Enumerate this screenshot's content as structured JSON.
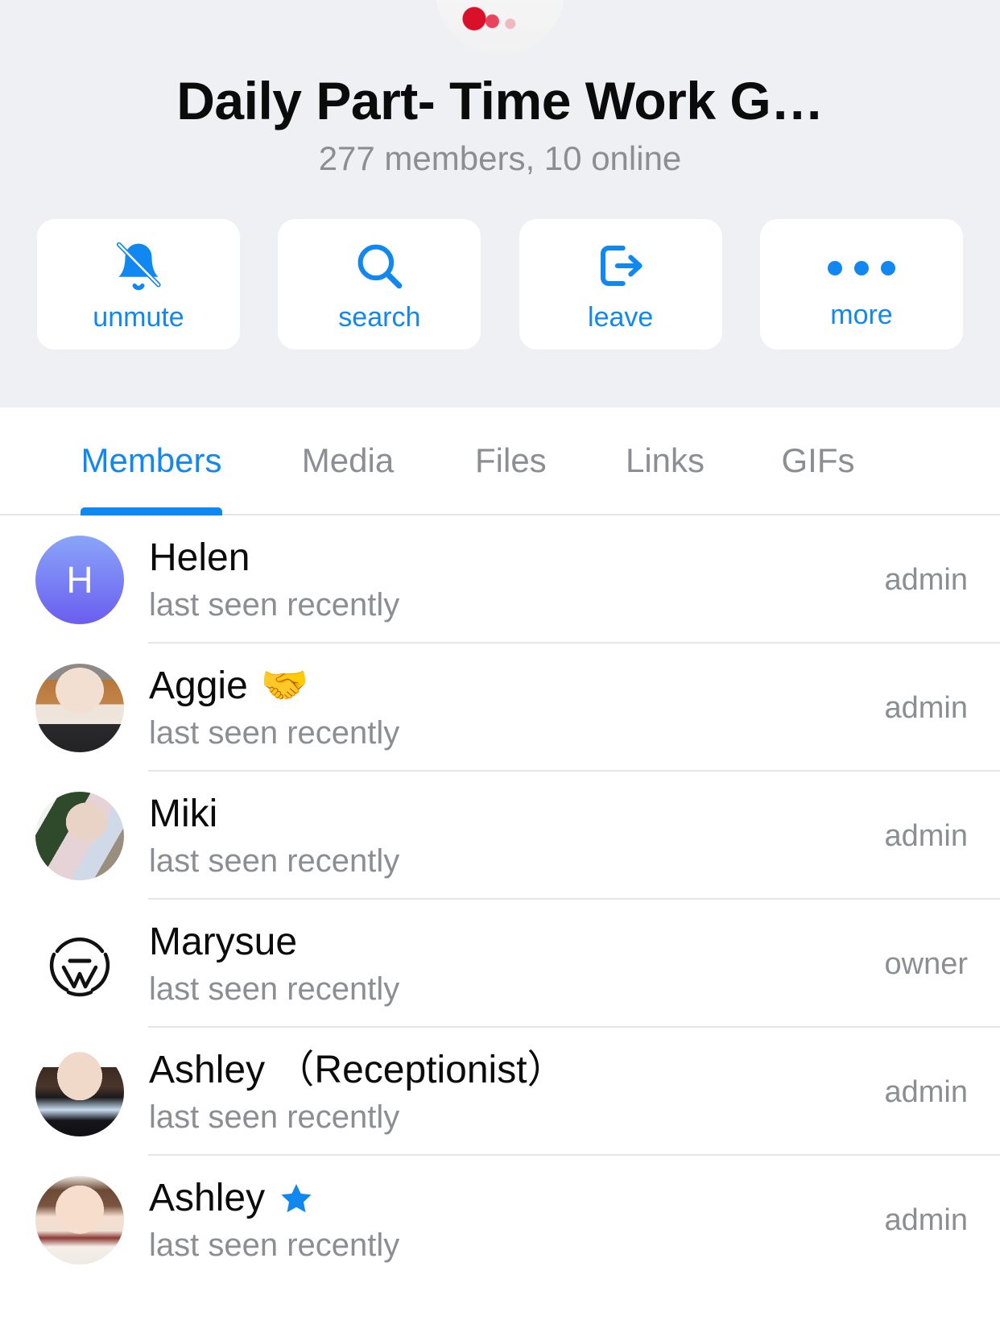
{
  "header": {
    "avatar_icon": "group-photo-avatar",
    "title": "Daily Part- Time Work G…",
    "subtitle": "277 members, 10 online",
    "background_color": "#eef0f4",
    "accent_color": "#1187f2"
  },
  "actions": [
    {
      "label": "unmute",
      "icon": "bell-slash-icon"
    },
    {
      "label": "search",
      "icon": "search-icon"
    },
    {
      "label": "leave",
      "icon": "leave-arrow-icon"
    },
    {
      "label": "more",
      "icon": "ellipsis-icon"
    }
  ],
  "tabs": [
    {
      "label": "Members",
      "active": true
    },
    {
      "label": "Media",
      "active": false
    },
    {
      "label": "Files",
      "active": false
    },
    {
      "label": "Links",
      "active": false
    },
    {
      "label": "GIFs",
      "active": false
    }
  ],
  "members": [
    {
      "name": "Helen",
      "badge": "",
      "status": "last seen recently",
      "role": "admin",
      "avatar_type": "letter",
      "avatar_letter": "H"
    },
    {
      "name": "Aggie",
      "badge": "🤝",
      "status": "last seen recently",
      "role": "admin",
      "avatar_type": "photo-aggie",
      "avatar_letter": ""
    },
    {
      "name": "Miki",
      "badge": "",
      "status": "last seen recently",
      "role": "admin",
      "avatar_type": "photo-miki",
      "avatar_letter": ""
    },
    {
      "name": "Marysue",
      "badge": "",
      "status": "last seen recently",
      "role": "owner",
      "avatar_type": "logo-w",
      "avatar_letter": ""
    },
    {
      "name": "Ashley （Receptionist）",
      "badge": "",
      "status": "last seen recently",
      "role": "admin",
      "avatar_type": "photo-ashley1",
      "avatar_letter": ""
    },
    {
      "name": "Ashley",
      "badge": "⭐",
      "status": "last seen recently",
      "role": "admin",
      "avatar_type": "photo-ashley2",
      "avatar_letter": ""
    }
  ]
}
